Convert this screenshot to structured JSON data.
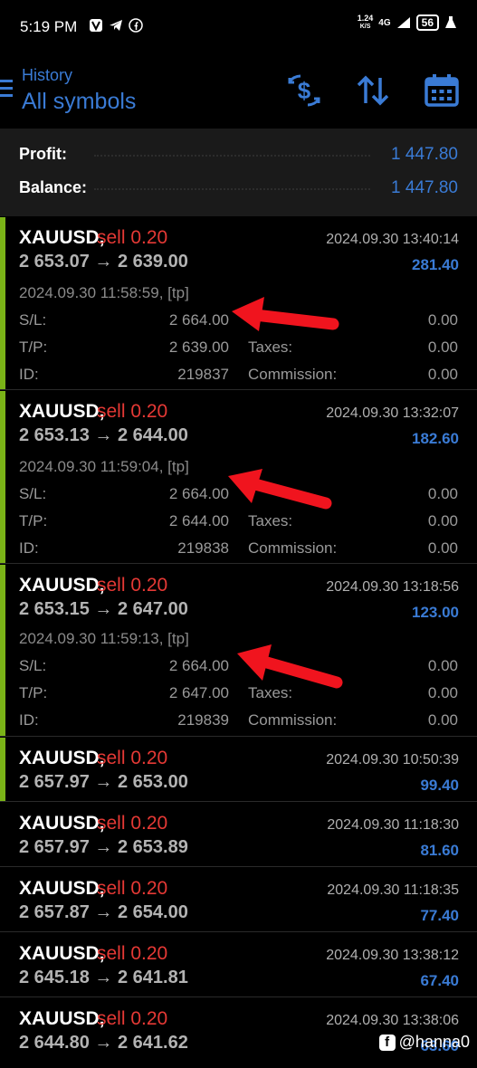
{
  "status_bar": {
    "time": "5:19 PM",
    "net_speed_value": "1.24",
    "net_speed_unit": "K/S",
    "network": "4G",
    "battery": "56"
  },
  "header": {
    "title": "History",
    "subtitle": "All symbols"
  },
  "summary": {
    "profit_label": "Profit:",
    "profit_value": "1 447.80",
    "balance_label": "Balance:",
    "balance_value": "1 447.80"
  },
  "labels": {
    "sl": "S/L:",
    "tp": "T/P:",
    "id": "ID:",
    "taxes": "Taxes:",
    "commission": "Commission:"
  },
  "deals": [
    {
      "symbol": "XAUUSD,",
      "side": "sell 0.20",
      "close_time": "2024.09.30 13:40:14",
      "prices": "2 653.07 → 2 639.00",
      "profit": "281.40",
      "open_time": "2024.09.30 11:58:59, [tp]",
      "sl": "2 664.00",
      "swap": "0.00",
      "tp": "2 639.00",
      "taxes": "0.00",
      "id": "219837",
      "commission": "0.00"
    },
    {
      "symbol": "XAUUSD,",
      "side": "sell 0.20",
      "close_time": "2024.09.30 13:32:07",
      "prices": "2 653.13 → 2 644.00",
      "profit": "182.60",
      "open_time": "2024.09.30 11:59:04, [tp]",
      "sl": "2 664.00",
      "swap": "0.00",
      "tp": "2 644.00",
      "taxes": "0.00",
      "id": "219838",
      "commission": "0.00"
    },
    {
      "symbol": "XAUUSD,",
      "side": "sell 0.20",
      "close_time": "2024.09.30 13:18:56",
      "prices": "2 653.15 → 2 647.00",
      "profit": "123.00",
      "open_time": "2024.09.30 11:59:13, [tp]",
      "sl": "2 664.00",
      "swap": "0.00",
      "tp": "2 647.00",
      "taxes": "0.00",
      "id": "219839",
      "commission": "0.00"
    },
    {
      "symbol": "XAUUSD,",
      "side": "sell 0.20",
      "close_time": "2024.09.30 10:50:39",
      "prices": "2 657.97 → 2 653.00",
      "profit": "99.40"
    },
    {
      "symbol": "XAUUSD,",
      "side": "sell 0.20",
      "close_time": "2024.09.30 11:18:30",
      "prices": "2 657.97 → 2 653.89",
      "profit": "81.60"
    },
    {
      "symbol": "XAUUSD,",
      "side": "sell 0.20",
      "close_time": "2024.09.30 11:18:35",
      "prices": "2 657.87 → 2 654.00",
      "profit": "77.40"
    },
    {
      "symbol": "XAUUSD,",
      "side": "sell 0.20",
      "close_time": "2024.09.30 13:38:12",
      "prices": "2 645.18 → 2 641.81",
      "profit": "67.40"
    },
    {
      "symbol": "XAUUSD,",
      "side": "sell 0.20",
      "close_time": "2024.09.30 13:38:06",
      "prices": "2 644.80 → 2 641.62",
      "profit": "63.60"
    }
  ],
  "watermark": "@hanna0",
  "colors": {
    "accent": "#3a7bd5",
    "sell": "#e53935",
    "bar": "#7ab317",
    "annotation_arrow": "#f0141e"
  }
}
